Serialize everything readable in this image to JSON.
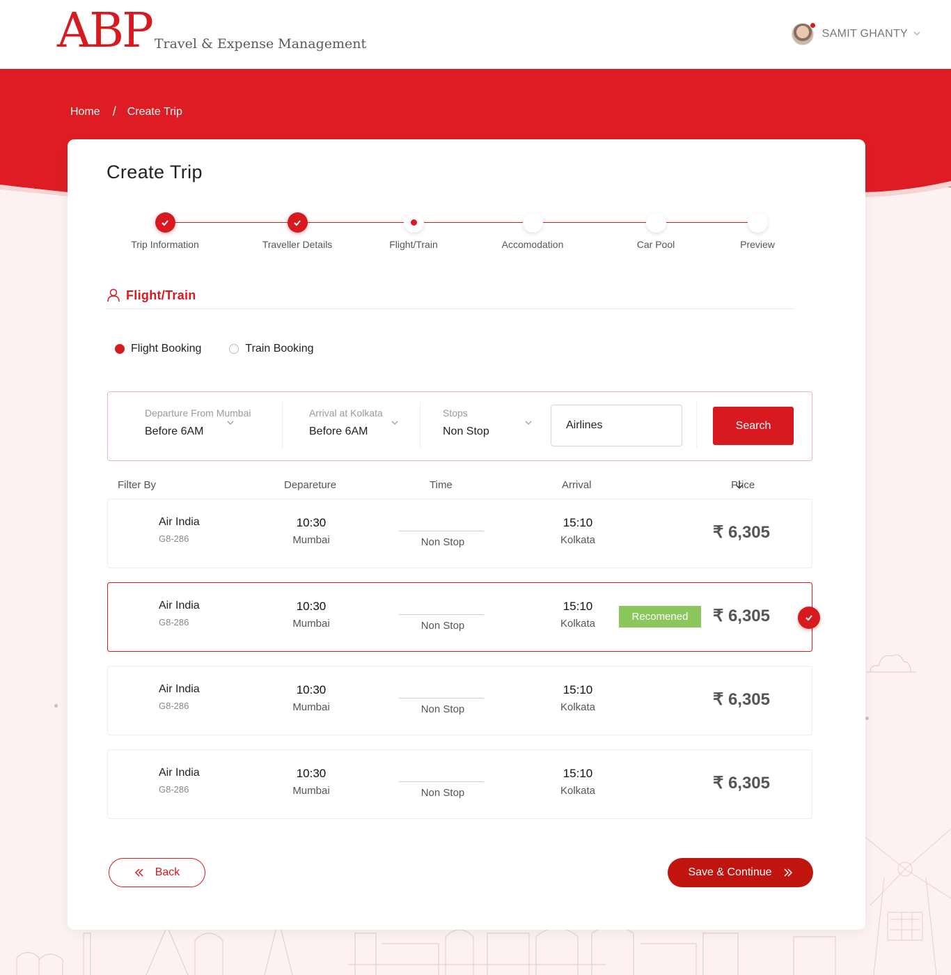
{
  "header": {
    "logo_text": "ABP",
    "logo_subtitle": "Travel & Expense Management",
    "user_name": "SAMIT GHANTY"
  },
  "breadcrumb": {
    "home": "Home",
    "separator": "/",
    "current": "Create Trip"
  },
  "page": {
    "title": "Create Trip"
  },
  "stepper": {
    "steps": [
      {
        "label": "Trip Information",
        "status": "done"
      },
      {
        "label": "Traveller Details",
        "status": "done"
      },
      {
        "label": "Flight/Train",
        "status": "current"
      },
      {
        "label": "Accomodation",
        "status": "pending"
      },
      {
        "label": "Car Pool",
        "status": "pending"
      },
      {
        "label": "Preview",
        "status": "pending"
      }
    ]
  },
  "section": {
    "title": "Flight/Train"
  },
  "booking_type": {
    "options": [
      "Flight Booking",
      "Train Booking"
    ],
    "selected": "Flight Booking"
  },
  "filters": {
    "departure": {
      "label": "Departure From Mumbai",
      "value": "Before 6AM"
    },
    "arrival": {
      "label": "Arrival at Kolkata",
      "value": "Before 6AM"
    },
    "stops": {
      "label": "Stops",
      "value": "Non Stop"
    },
    "airlines": {
      "value": "Airlines"
    },
    "search_label": "Search"
  },
  "table_header": {
    "filter_by": "Filter By",
    "departure": "Depareture",
    "time": "Time",
    "arrival": "Arrival",
    "price": "Price"
  },
  "flights": [
    {
      "airline": "Air India",
      "code": "G8-286",
      "dep_time": "10:30",
      "dep_city": "Mumbai",
      "stops": "Non Stop",
      "arr_time": "15:10",
      "arr_city": "Kolkata",
      "price": "6,305",
      "currency": "₹"
    },
    {
      "airline": "Air India",
      "code": "G8-286",
      "dep_time": "10:30",
      "dep_city": "Mumbai",
      "stops": "Non Stop",
      "arr_time": "15:10",
      "arr_city": "Kolkata",
      "price": "6,305",
      "currency": "₹",
      "badge": "Recomened",
      "selected": true
    },
    {
      "airline": "Air India",
      "code": "G8-286",
      "dep_time": "10:30",
      "dep_city": "Mumbai",
      "stops": "Non Stop",
      "arr_time": "15:10",
      "arr_city": "Kolkata",
      "price": "6,305",
      "currency": "₹"
    },
    {
      "airline": "Air India",
      "code": "G8-286",
      "dep_time": "10:30",
      "dep_city": "Mumbai",
      "stops": "Non Stop",
      "arr_time": "15:10",
      "arr_city": "Kolkata",
      "price": "6,305",
      "currency": "₹"
    }
  ],
  "footer": {
    "back_label": "Back",
    "save_label": "Save & Continue"
  },
  "colors": {
    "brand_red": "#d71920",
    "banner_red": "#de1c23",
    "recommended_green": "#8cc75e",
    "page_bg": "#fcf2f2"
  },
  "icons": {
    "user": "user-outline-icon",
    "check": "check-icon",
    "sort": "arrow-down-icon",
    "back": "double-chevron-left-icon",
    "forward": "double-chevron-right-icon"
  }
}
